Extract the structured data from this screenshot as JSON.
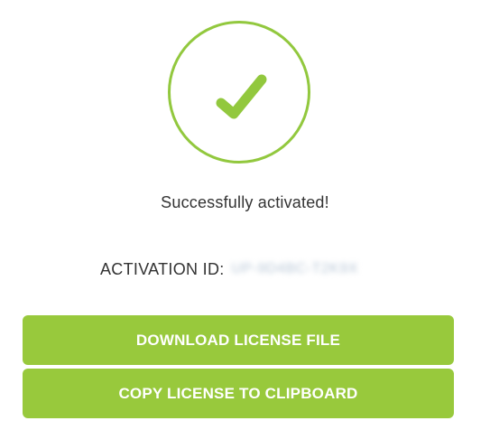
{
  "status": {
    "icon": "checkmark-icon",
    "message": "Successfully activated!"
  },
  "activation": {
    "label": "ACTIVATION ID:",
    "value": "UP-9D4BC-T2K9X"
  },
  "actions": {
    "download_label": "DOWNLOAD LICENSE FILE",
    "copy_label": "COPY LICENSE TO CLIPBOARD"
  },
  "colors": {
    "accent": "#98c93c",
    "text": "#333333",
    "button_text": "#ffffff"
  }
}
